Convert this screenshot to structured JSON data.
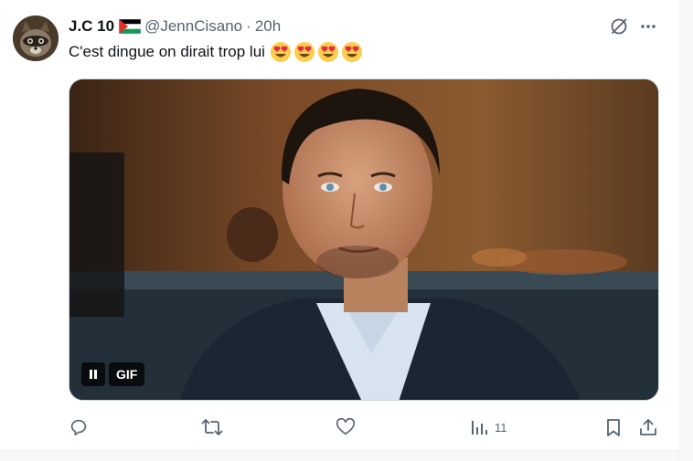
{
  "tweet": {
    "author": {
      "display_name": "J.C 10",
      "flag_icon": "palestine-flag-icon",
      "handle": "@JennCisano",
      "separator": "·",
      "time": "20h"
    },
    "text": "C'est dingue on dirait trop lui",
    "emojis": [
      "heart-eyes-emoji",
      "heart-eyes-emoji",
      "heart-eyes-emoji",
      "heart-eyes-emoji"
    ],
    "media": {
      "type": "gif",
      "badge": "GIF",
      "pause_icon": "pause-icon"
    },
    "actions": {
      "reply_icon": "reply-icon",
      "retweet_icon": "retweet-icon",
      "like_icon": "like-icon",
      "views_icon": "views-icon",
      "views_count": "11",
      "bookmark_icon": "bookmark-icon",
      "share_icon": "share-icon"
    },
    "top_icons": [
      "grok-icon",
      "more-icon"
    ]
  },
  "colors": {
    "text_primary": "#0f1419",
    "text_secondary": "#536471",
    "border": "#cfd9de"
  }
}
